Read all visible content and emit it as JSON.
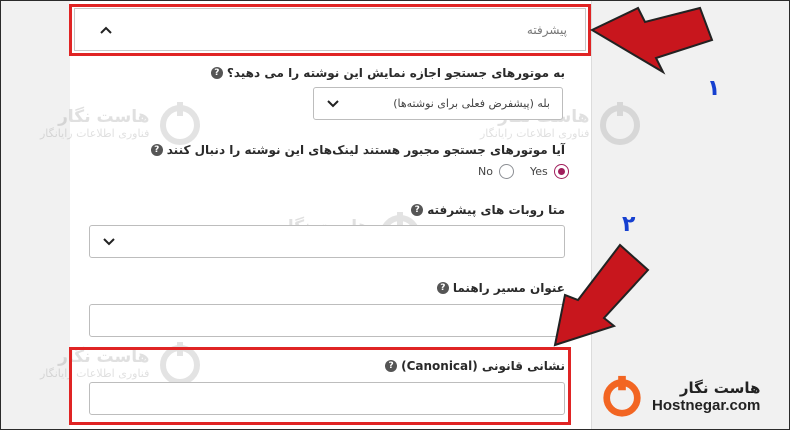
{
  "accordion": {
    "title": "پیشرفته"
  },
  "fields": {
    "robots_index": {
      "label": "به موتورهای جستجو اجازه نمایش این نوشته را می دهید؟",
      "selected": "بله (پیشفرض فعلی برای نوشته‌ها)"
    },
    "robots_follow": {
      "label": "آیا موتورهای جستجو مجبور هستند لینک‌های این نوشته را دنبال کنند",
      "options": [
        "Yes",
        "No"
      ],
      "selected": "Yes"
    },
    "meta_robots_advanced": {
      "label": "متا روبات های پیشرفته",
      "selected": ""
    },
    "breadcrumb_title": {
      "label": "عنوان مسیر راهنما",
      "value": ""
    },
    "canonical_url": {
      "label": "نشانی قانونی (Canonical)",
      "value": ""
    }
  },
  "help_symbol": "?",
  "annotations": {
    "step1": "۱",
    "step2": "۲"
  },
  "watermark": {
    "name": "هاست نگار",
    "tagline": "فناوری اطلاعات رایانگار"
  },
  "brand": {
    "name_fa": "هاست نگار",
    "domain": "Hostnegar.com"
  },
  "colors": {
    "highlight": "#e02424",
    "arrow": "#c8161d",
    "step_number": "#1640d0",
    "radio_checked": "#a01d5b",
    "brand_orange": "#f26522"
  }
}
